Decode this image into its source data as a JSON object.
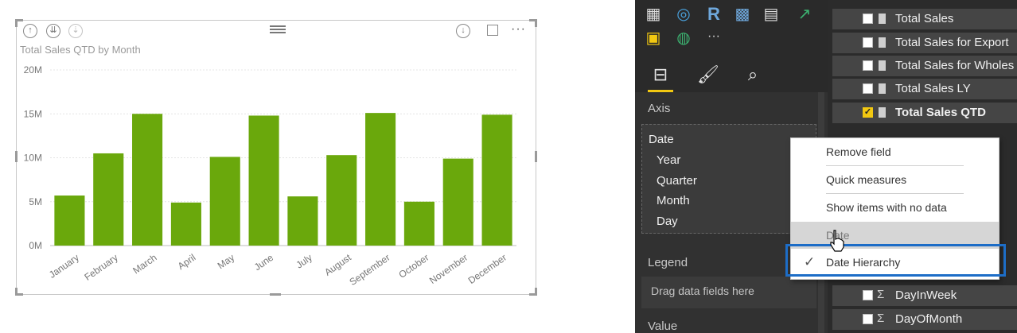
{
  "visual": {
    "header_icons": [
      "drill-up-icon",
      "expand-next-level-icon",
      "drill-down-icon",
      "focus-mode-download-icon",
      "expand-icon",
      "more-options-icon"
    ],
    "more_label": "···"
  },
  "chart_data": {
    "type": "bar",
    "title": "Total Sales QTD by Month",
    "categories": [
      "January",
      "February",
      "March",
      "April",
      "May",
      "June",
      "July",
      "August",
      "September",
      "October",
      "November",
      "December"
    ],
    "values": [
      5.7,
      10.5,
      15.0,
      4.9,
      10.1,
      14.8,
      5.6,
      10.3,
      15.1,
      5.0,
      9.9,
      14.9
    ],
    "unit": "M",
    "yticks": [
      "0M",
      "5M",
      "10M",
      "15M",
      "20M"
    ],
    "ylim": [
      0,
      20
    ],
    "bar_color": "#6aa80c",
    "grid": true,
    "legend": false
  },
  "viz_pane": {
    "icons": [
      "stacked-bar-icon",
      "donut-icon",
      "r-script-icon",
      "filled-map-icon",
      "table-icon",
      "kpi-icon",
      "card-icon",
      "globe-icon",
      "more-visuals-icon"
    ],
    "r_label": "R",
    "more_label": "···",
    "tabs": [
      "fields-tab",
      "format-tab",
      "analytics-tab"
    ],
    "axis_label": "Axis",
    "axis_field": "Date",
    "hierarchy": [
      "Year",
      "Quarter",
      "Month",
      "Day"
    ],
    "legend_label": "Legend",
    "legend_placeholder": "Drag data fields here",
    "value_label": "Value"
  },
  "fields_pane": {
    "rows": [
      {
        "name": "Total Sales",
        "checked": false,
        "type": "measure"
      },
      {
        "name": "Total Sales for Export",
        "checked": false,
        "type": "measure"
      },
      {
        "name": "Total Sales for Wholes",
        "checked": false,
        "type": "measure"
      },
      {
        "name": "Total Sales LY",
        "checked": false,
        "type": "measure"
      },
      {
        "name": "Total Sales QTD",
        "checked": true,
        "type": "measure"
      },
      {
        "name": "DayInWeek",
        "checked": false,
        "type": "sum"
      },
      {
        "name": "DayOfMonth",
        "checked": false,
        "type": "sum"
      }
    ]
  },
  "context_menu": {
    "items": [
      "Remove field",
      "Quick measures",
      "Show items with no data",
      "Date",
      "Date Hierarchy"
    ],
    "checked_item": "Date Hierarchy",
    "check_mark": "✓",
    "highlight_color": "#1d6dc7"
  }
}
